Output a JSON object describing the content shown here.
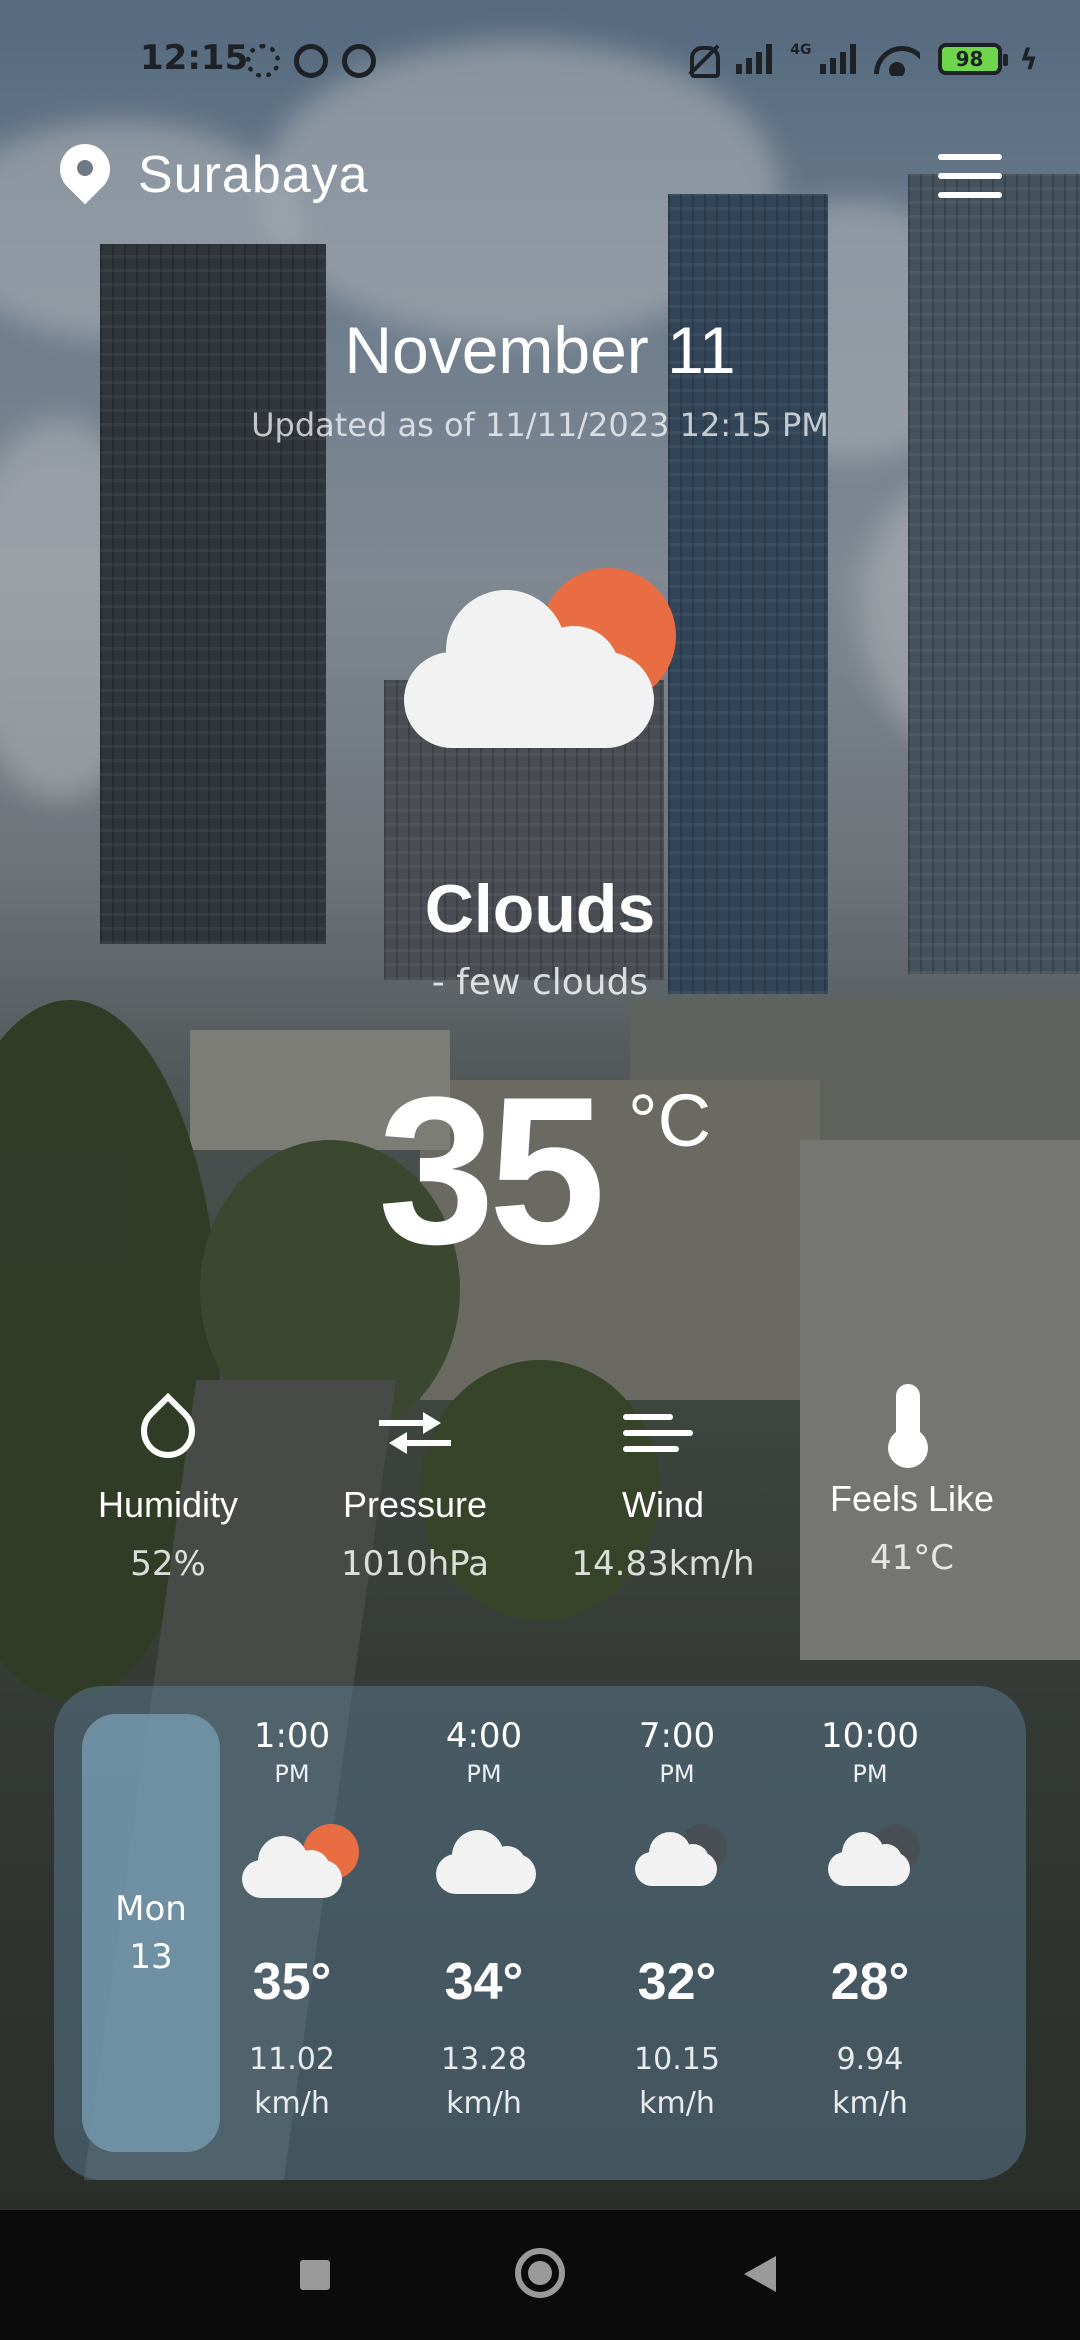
{
  "status_bar": {
    "time": "12:15",
    "network_label": "4G",
    "battery": "98",
    "icons": [
      "gear-icon",
      "vpn-icon",
      "vpn-icon",
      "bell-muted-icon",
      "signal-icon",
      "signal-4g-icon",
      "wifi-icon",
      "battery-icon",
      "charging-icon"
    ]
  },
  "header": {
    "city": "Surabaya",
    "location_icon": "location-pin-icon",
    "menu_icon": "hamburger-menu-icon"
  },
  "current": {
    "date": "November 11",
    "updated": "Updated as of 11/11/2023 12:15 PM",
    "icon": "sun-behind-cloud-icon",
    "condition": "Clouds",
    "description": "- few clouds",
    "temperature": "35",
    "unit": "°C"
  },
  "metrics": [
    {
      "icon": "humidity-drop-icon",
      "label": "Humidity",
      "value": "52%"
    },
    {
      "icon": "pressure-arrows-icon",
      "label": "Pressure",
      "value": "1010hPa"
    },
    {
      "icon": "wind-icon",
      "label": "Wind",
      "value": "14.83km/h"
    },
    {
      "icon": "thermometer-icon",
      "label": "Feels Like",
      "value": "41°C"
    }
  ],
  "forecast": {
    "day_name": "Mon",
    "day_number": "13",
    "hours": [
      {
        "time": "1:00",
        "ampm": "PM",
        "icon": "sun-behind-cloud-icon",
        "temp": "35°",
        "wind_value": "11.02",
        "wind_unit": "km/h"
      },
      {
        "time": "4:00",
        "ampm": "PM",
        "icon": "cloud-icon",
        "temp": "34°",
        "wind_value": "13.28",
        "wind_unit": "km/h"
      },
      {
        "time": "7:00",
        "ampm": "PM",
        "icon": "cloud-night-icon",
        "temp": "32°",
        "wind_value": "10.15",
        "wind_unit": "km/h"
      },
      {
        "time": "10:00",
        "ampm": "PM",
        "icon": "cloud-night-icon",
        "temp": "28°",
        "wind_value": "9.94",
        "wind_unit": "km/h"
      }
    ]
  },
  "nav_bar": {
    "icons": [
      "recents-square-icon",
      "home-circle-icon",
      "back-triangle-icon"
    ]
  },
  "colors": {
    "sun": "#e96d43",
    "cloud": "#f2f2f2",
    "card": "#58768a",
    "pill": "#789eb2"
  }
}
